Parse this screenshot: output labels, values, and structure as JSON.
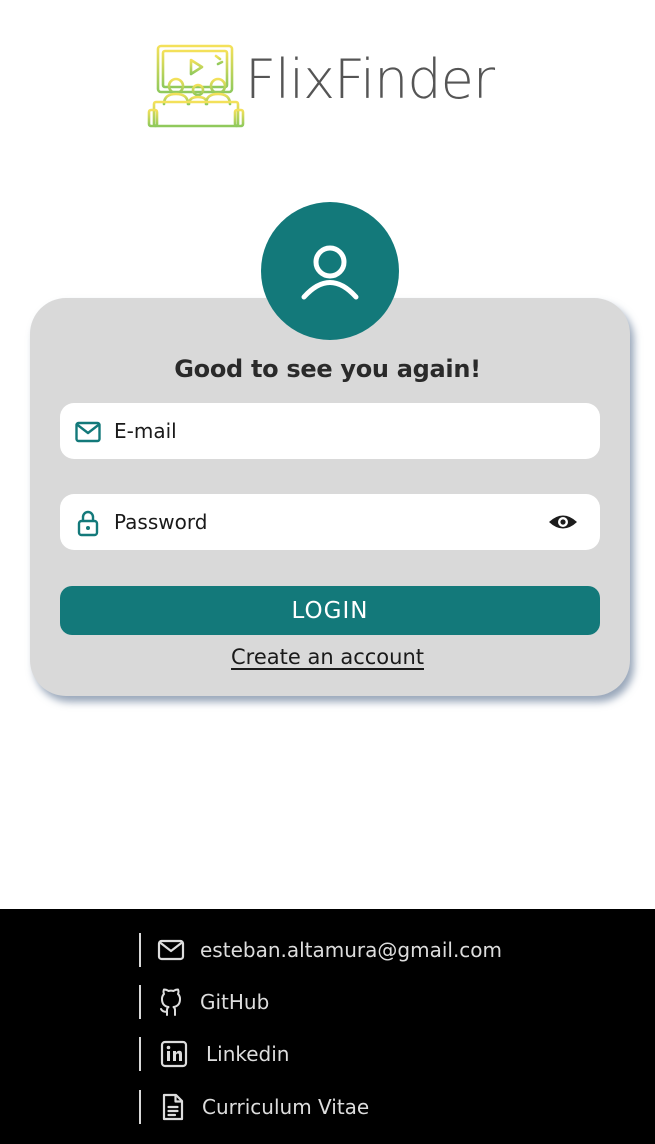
{
  "brand": {
    "name": "FlixFinder",
    "logo_icon": "cinema-audience-icon",
    "logo_colors": [
      "#f4e15a",
      "#9ccc5e"
    ]
  },
  "login_card": {
    "avatar_icon": "user-icon",
    "heading": "Good to see you again!",
    "email": {
      "icon": "mail-icon",
      "placeholder": "E-mail",
      "value": ""
    },
    "password": {
      "icon": "lock-icon",
      "placeholder": "Password",
      "value": "",
      "toggle_icon": "eye-icon"
    },
    "login_button": "LOGIN",
    "create_account_link": "Create an account"
  },
  "footer": {
    "links": [
      {
        "icon": "mail-icon",
        "label": "esteban.altamura@gmail.com"
      },
      {
        "icon": "github-icon",
        "label": "GitHub"
      },
      {
        "icon": "linkedin-icon",
        "label": "Linkedin"
      },
      {
        "icon": "document-icon",
        "label": "Curriculum Vitae"
      }
    ]
  },
  "colors": {
    "accent": "#13797a",
    "card_background": "#d9d9d9",
    "footer_background": "#000000"
  }
}
